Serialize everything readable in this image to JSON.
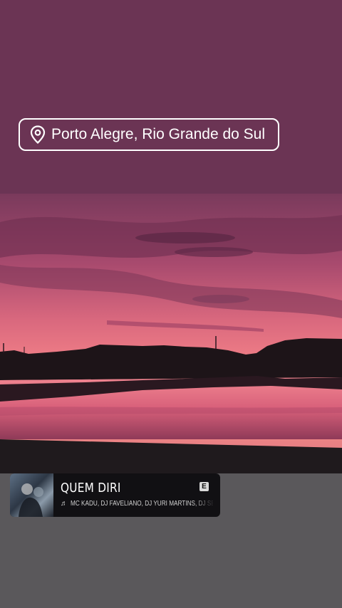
{
  "location": {
    "label": "Porto Alegre, Rio Grande do Sul",
    "icon": "map-pin-icon"
  },
  "photo": {
    "description_icon": "sunset-photo"
  },
  "music": {
    "title": "QUEM DIRI",
    "explicit": "E",
    "note_icon": "♬",
    "artists": "MC KADU, DJ FAVELIANO, DJ YURI MARTINS, DJ SE"
  },
  "colors": {
    "top_band": "#6b3454",
    "bottom_band": "#5a585b",
    "sticker_bg": "#111013"
  }
}
